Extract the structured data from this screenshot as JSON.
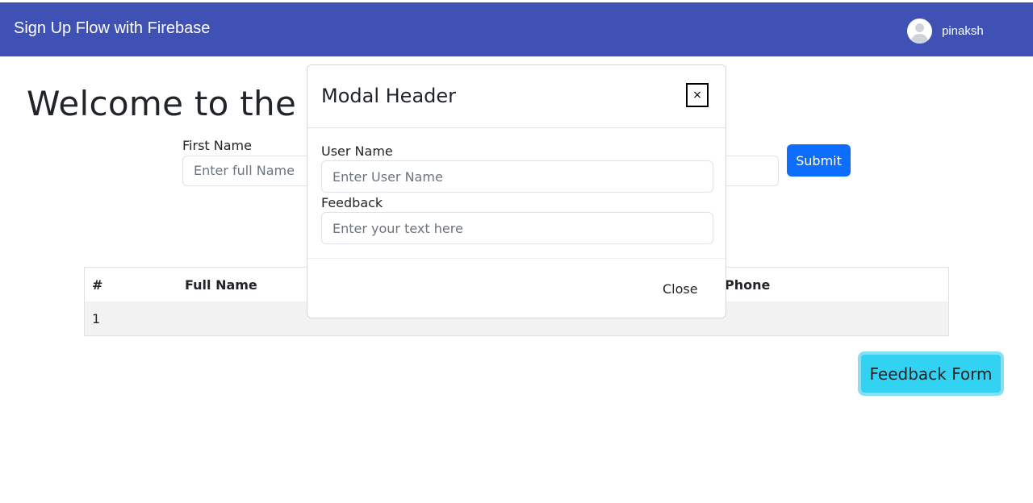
{
  "navbar": {
    "brand": "Sign Up Flow with Firebase",
    "username": "pinaksh"
  },
  "main": {
    "welcome": "Welcome to the ho",
    "first_name_label": "First Name",
    "first_name_placeholder": "Enter full Name",
    "submit_label": "Submit"
  },
  "table": {
    "headers": [
      "#",
      "Full Name",
      "Phone"
    ],
    "rows": [
      [
        "1"
      ]
    ]
  },
  "feedback_button": "Feedback Form",
  "modal": {
    "title": "Modal Header",
    "close_glyph": "×",
    "username_label": "User Name",
    "username_placeholder": "Enter User Name",
    "feedback_label": "Feedback",
    "feedback_placeholder": "Enter your text here",
    "close_label": "Close"
  },
  "colors": {
    "navbar": "#3f51b5",
    "primary": "#0d6efd",
    "info": "#31d2f2"
  }
}
